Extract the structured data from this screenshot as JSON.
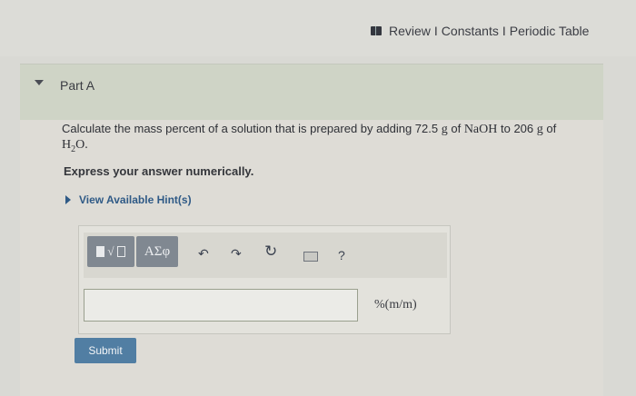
{
  "header": {
    "links": [
      "Review",
      "Constants",
      "Periodic Table"
    ],
    "separator": "I"
  },
  "part": {
    "title": "Part A"
  },
  "question": {
    "text_prefix": "Calculate the mass percent of a solution that is prepared by adding 72.5",
    "unit_g": "g",
    "text_of": "of",
    "solute": "NaOH",
    "text_to": "to 206",
    "unit_g2": "g",
    "text_of2": "of",
    "solvent_base": "H",
    "solvent_sub": "2",
    "solvent_tail": "O."
  },
  "instruction": "Express your answer numerically.",
  "hint_label": "View Available Hint(s)",
  "toolbar": {
    "radical_symbol": "√",
    "greek_label": "ΑΣφ",
    "undo_glyph": "↶",
    "redo_glyph": "↷",
    "reset_glyph": "↻",
    "help_label": "?",
    "icons": [
      "template-icon",
      "greek-icon",
      "undo-icon",
      "redo-icon",
      "reset-icon",
      "keyboard-icon",
      "help-icon"
    ]
  },
  "answer": {
    "value": "",
    "units": "%(m/m)"
  },
  "submit_label": "Submit",
  "colors": {
    "accent": "#517ea3",
    "link": "#2f5a86",
    "toolbar_button": "#808891"
  }
}
